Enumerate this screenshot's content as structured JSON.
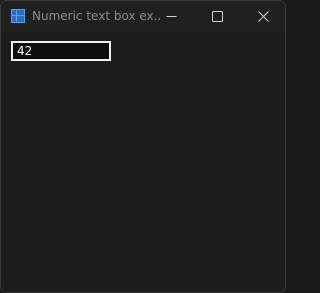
{
  "window": {
    "title": "Numeric text box ex..."
  },
  "titlebar": {
    "app_icon": "app-grid-icon",
    "controls": {
      "minimize_icon": "minimize-icon",
      "maximize_icon": "maximize-icon",
      "close_icon": "close-icon"
    }
  },
  "form": {
    "numeric_value": "42"
  },
  "colors": {
    "window_background": "#1c1c1c",
    "titlebar_background": "#202020",
    "title_text": "#8a8a8a",
    "input_border": "#f2f2f2",
    "icon_accent": "#4aa3f0"
  }
}
